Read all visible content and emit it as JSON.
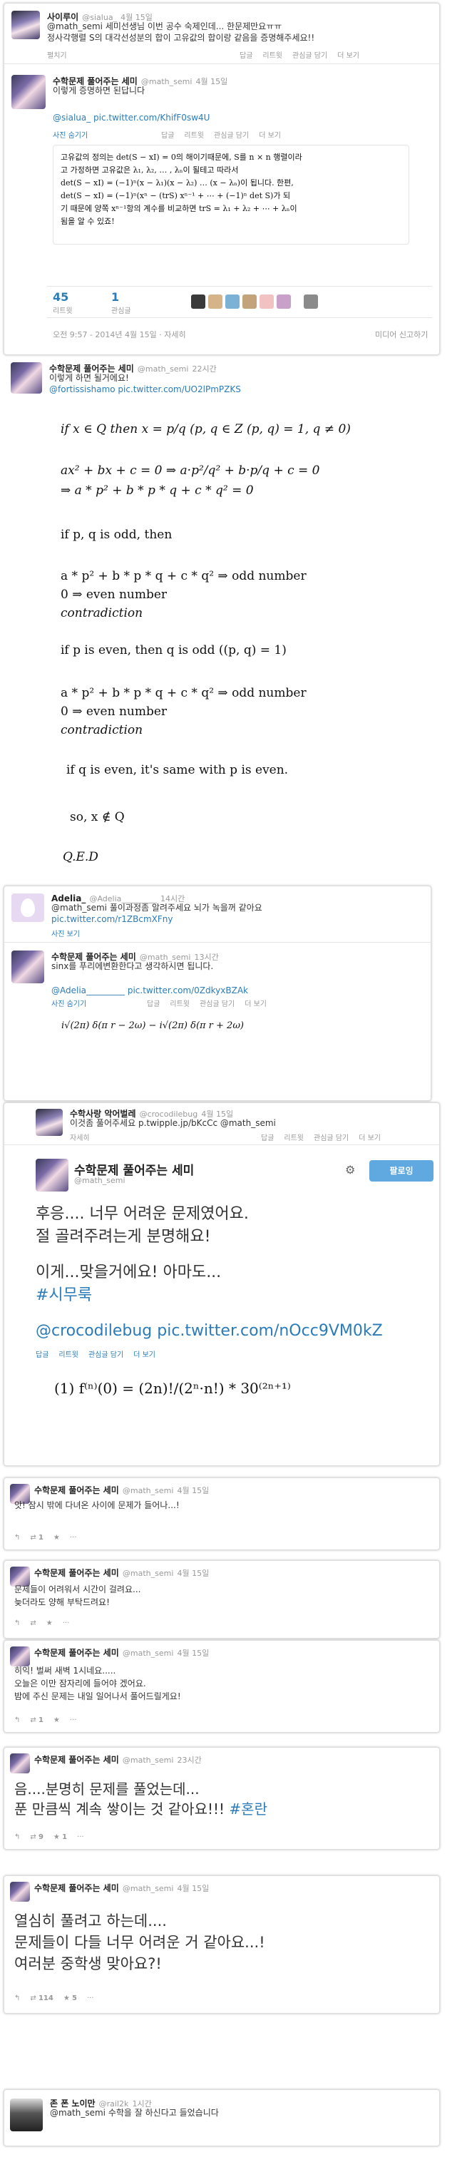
{
  "t1": {
    "name": "사이루이",
    "handle": "@sialua_",
    "time": "4월 15일",
    "text1": "@math_semi 세미선생님 이번 공수 숙제인데... 한문제만요ㅠㅠ",
    "text2": "정사각행렬 S의 대각선성분의 합이 고유값의 합이랑 같음을 증명해주세요!!",
    "expand": "펼치기",
    "actions": [
      "답글",
      "리트윗",
      "관심글 담기",
      "더 보기"
    ]
  },
  "t2": {
    "name": "수학문제 풀어주는 세미",
    "handle": "@math_semi",
    "time": "4월 15일",
    "text": "이렇게 증명하면 된답니다",
    "link": "@sialua_ pic.twitter.com/KhifF0sw4U",
    "photo": "사진 숨기기",
    "math_lines": [
      "고유값의 정의는 det(S − xI) = 0의 해이기때문에, S를 n × n 행렬이라",
      "고 가정하면 고유값은 λ₁, λ₂, … , λₙ이 될테고 따라서",
      "det(S − xI) = (−1)ⁿ(x − λ₁)(x − λ₂) … (x − λₙ)이 됩니다. 한편,",
      "det(S − xI) = (−1)ⁿ(xⁿ − (trS) xⁿ⁻¹ + ⋯ + (−1)ⁿ det S)가 되",
      "기 때문에 양쪽 xⁿ⁻¹항의 계수를 비교하면 trS = λ₁ + λ₂ + ⋯ + λₙ이",
      "됨을 알 수 있죠!"
    ],
    "actions": [
      "답글",
      "리트윗",
      "관심글 담기",
      "더 보기"
    ],
    "rt_count": "45",
    "rt_label": "리트윗",
    "fav_count": "1",
    "fav_label": "관심글",
    "footer_time": "오전 9:57 - 2014년 4월 15일 · 자세히",
    "footer_right": "미디어 신고하기"
  },
  "t3": {
    "name": "수학문제 풀어주는 세미",
    "handle": "@math_semi",
    "time": "22시간",
    "text": "이렇게 하면 될거에요!",
    "link": "@fortissishamo pic.twitter.com/UO2lPmPZKS",
    "proof": [
      "if  x ∈ Q  then  x = p/q  (p, q ∈ Z (p, q) = 1,  q ≠ 0)",
      "ax² + bx + c = 0  ⇒  a·p²/q² + b·p/q + c = 0",
      "⇒  a * p² + b * p * q + c * q² = 0",
      "if p, q is odd, then",
      "a * p² + b * p * q + c * q² ⇒ odd number",
      "0 ⇒ even number",
      "contradiction",
      "if p is even, then q is odd ((p, q) = 1)",
      "a * p² + b * p * q + c * q² ⇒ odd number",
      "0 ⇒ even number",
      "contradiction",
      "if q is even, it's same with p is even.",
      "so, x ∉ Q",
      "Q.E.D"
    ]
  },
  "t4": {
    "name": "Adelia_",
    "handle": "@Adelia_________",
    "time": "14시간",
    "text": "@math_semi 풀이과정좀 알려주세요 뇌가 녹을꺼 같아요",
    "link": "pic.twitter.com/r1ZBcmXFny",
    "photo": "사진 보기"
  },
  "t5": {
    "name": "수학문제 풀어주는 세미",
    "handle": "@math_semi",
    "time": "13시간",
    "text": "sinx를 푸리에변환한다고 생각하시면 됩니다.",
    "link": "@Adelia_________ pic.twitter.com/0ZdkyxBZAk",
    "photo": "사진 숨기기",
    "actions": [
      "답글",
      "리트윗",
      "관심글 담기",
      "더 보기"
    ],
    "formula": "i√(2π) δ(π r − 2ω) − i√(2π) δ(π r + 2ω)"
  },
  "t6": {
    "name": "수학사랑 악어벌레",
    "handle": "@crocodilebug",
    "time": "4월 15일",
    "text": "이것좀 풀어주세요 p.twipple.jp/bKcCc @math_semi",
    "more": "자세히",
    "actions": [
      "답글",
      "리트윗",
      "관심글 담기",
      "더 보기"
    ]
  },
  "t7": {
    "name": "수학문제 풀어주는 세미",
    "handle": "@math_semi",
    "follow": "팔로잉",
    "line1": "후응.... 너무 어려운 문제였어요.",
    "line2": "절 골려주려는게 분명해요!",
    "line3": "이게...맞을거에요! 아마도...",
    "hashtag": "#시무룩",
    "link": "@crocodilebug pic.twitter.com/nOcc9VM0kZ",
    "actions": [
      "답글",
      "리트윗",
      "관심글 담기",
      "더 보기"
    ],
    "formula": "(1)  f⁽ⁿ⁾(0) = (2n)!/(2ⁿ·n!) * 30⁽²ⁿ⁺¹⁾"
  },
  "t8": {
    "name": "수학문제 풀어주는 세미",
    "handle": "@math_semi",
    "time": "4월 15일",
    "text": "앗! 잠시 밖에 다녀온 사이에 문제가 들어나...!",
    "rt": "1"
  },
  "t9": {
    "name": "수학문제 풀어주는 세미",
    "handle": "@math_semi",
    "time": "4월 15일",
    "text1": "문제들이 어려워서 시간이 걸려요...",
    "text2": "늦더라도 양해 부탁드려요!"
  },
  "t10": {
    "name": "수학문제 풀어주는 세미",
    "handle": "@math_semi",
    "time": "4월 15일",
    "text1": "히익! 벌써 새벽 1시네요.....",
    "text2": "오늘은 이만 잠자리에 들어야 겠어요.",
    "text3": "밤에 주신 문제는 내일 일어나서 풀어드릴게요!",
    "rt": "1"
  },
  "t11": {
    "name": "수학문제 풀어주는 세미",
    "handle": "@math_semi",
    "time": "23시간",
    "line1": "음....분명히 문제를 풀었는데...",
    "line2": "푼 만큼씩 계속 쌓이는 것 같아요!!!",
    "hashtag": "#혼란",
    "rt": "9",
    "fav": "1"
  },
  "t12": {
    "name": "수학문제 풀어주는 세미",
    "handle": "@math_semi",
    "time": "4월 15일",
    "line1": "열심히 풀려고 하는데....",
    "line2": "문제들이 다들 너무 어려운 거 같아요...!",
    "line3": "여러분 중학생 맞아요?!",
    "rt": "114",
    "fav": "5"
  },
  "t13": {
    "name": "존 폰 노이만",
    "handle": "@rail2k",
    "time": "1시간",
    "text": "@math_semi 수학을 잘 하신다고 들었습니다"
  }
}
